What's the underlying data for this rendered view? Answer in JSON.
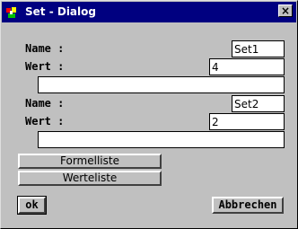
{
  "window": {
    "title": "Set - Dialog",
    "close_glyph": "×",
    "icon": "app-icon"
  },
  "sets": [
    {
      "name_label": "Name :",
      "name_value": "Set1",
      "wert_label": "Wert :",
      "wert_value": "4",
      "formula_value": ""
    },
    {
      "name_label": "Name :",
      "name_value": "Set2",
      "wert_label": "Wert :",
      "wert_value": "2",
      "formula_value": ""
    }
  ],
  "buttons": {
    "formelliste": "Formelliste",
    "werteliste": "Werteliste",
    "ok": "ok",
    "abbrechen": "Abbrechen"
  },
  "colors": {
    "titlebar": "#000080",
    "face": "#c0c0c0"
  }
}
